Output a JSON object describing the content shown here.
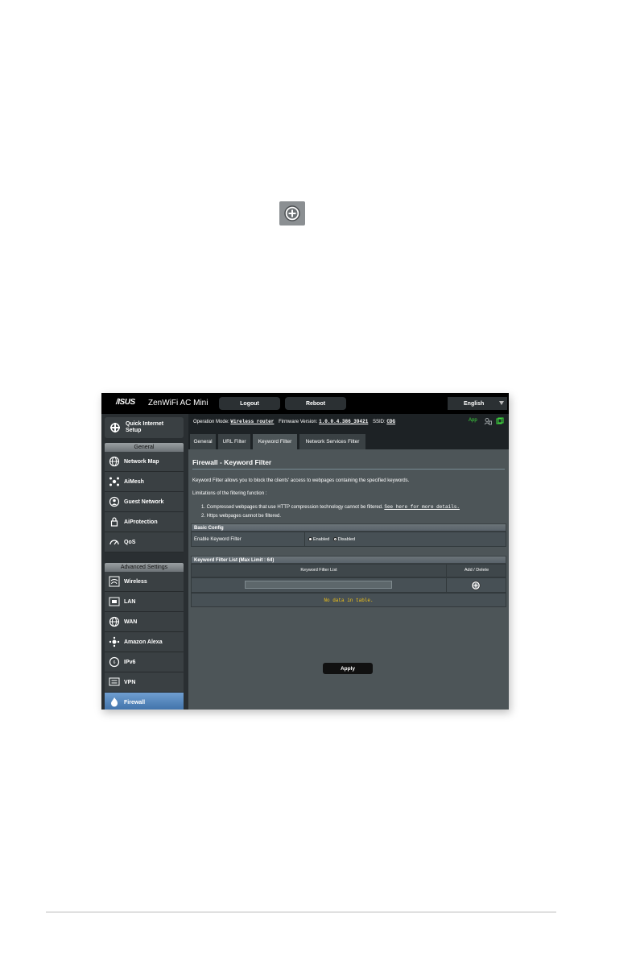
{
  "router": {
    "brand": "/ISUS",
    "product": "ZenWiFi AC Mini",
    "logout_label": "Logout",
    "reboot_label": "Reboot",
    "language": "English"
  },
  "status": {
    "operation_mode_label": "Operation Mode:",
    "operation_mode_value": "Wireless router",
    "firmware_label": "Firmware Version:",
    "firmware_value": "1.0.0.4.386_39421",
    "ssid_label": "SSID:",
    "ssid_value": "CDG",
    "app_label": "App"
  },
  "sidebar": {
    "qis_label": "Quick Internet\nSetup",
    "general_header": "General",
    "general_items": [
      {
        "label": "Network Map"
      },
      {
        "label": "AiMesh"
      },
      {
        "label": "Guest Network"
      },
      {
        "label": "AiProtection"
      },
      {
        "label": "QoS"
      }
    ],
    "advanced_header": "Advanced Settings",
    "advanced_items": [
      {
        "label": "Wireless"
      },
      {
        "label": "LAN"
      },
      {
        "label": "WAN"
      },
      {
        "label": "Amazon Alexa"
      },
      {
        "label": "IPv6"
      },
      {
        "label": "VPN"
      },
      {
        "label": "Firewall"
      }
    ]
  },
  "tabs": [
    {
      "label": "General"
    },
    {
      "label": "URL Filter"
    },
    {
      "label": "Keyword Filter"
    },
    {
      "label": "Network Services Filter"
    }
  ],
  "page": {
    "title": "Firewall - Keyword Filter",
    "description": "Keyword Filter allows you to block the clients' access to webpages containing the specified keywords.",
    "limitations": "Limitations of the filtering function :",
    "limit_1": "1.  Compressed webpages that use HTTP compression technology cannot be filtered.",
    "limit_1_link": "See here for more details.",
    "limit_2": "2.  Https webpages cannot be filtered."
  },
  "basic_config": {
    "header": "Basic Config",
    "enable_label": "Enable Keyword Filter",
    "enabled_option": "Enabled",
    "disabled_option": "Disabled",
    "selected": "Disabled"
  },
  "keyword_list": {
    "header": "Keyword Filter List (Max Limit : 64)",
    "col_list": "Keyword Filter List",
    "col_action": "Add / Delete",
    "input_value": "",
    "empty_text": "No data in table."
  },
  "apply_label": "Apply",
  "colors": {
    "accent_blue": "#3c6ea6",
    "empty_text": "#f5c518",
    "app_green": "#3fdc3f"
  }
}
